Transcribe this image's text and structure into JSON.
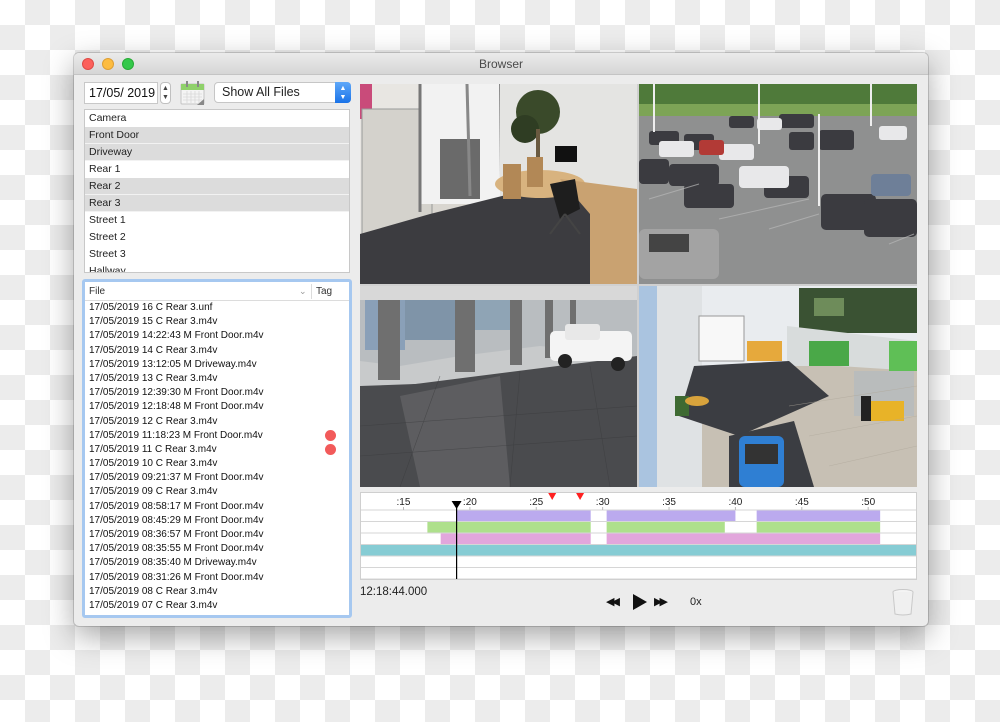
{
  "window": {
    "title": "Browser",
    "controls": [
      "close",
      "minimize",
      "maximize"
    ]
  },
  "toolbar": {
    "date_value": "17/05/ 2019",
    "calendar_icon": "calendar-icon",
    "filter_select_value": "Show All Files"
  },
  "camera_list": {
    "header": "Camera",
    "items": [
      {
        "label": "Front Door",
        "selected": true
      },
      {
        "label": "Driveway",
        "selected": true
      },
      {
        "label": "Rear 1",
        "selected": false
      },
      {
        "label": "Rear 2",
        "selected": true
      },
      {
        "label": "Rear 3",
        "selected": true
      },
      {
        "label": "Street 1",
        "selected": false
      },
      {
        "label": "Street 2",
        "selected": false
      },
      {
        "label": "Street 3",
        "selected": false
      },
      {
        "label": "Hallway",
        "selected": false
      }
    ]
  },
  "file_list": {
    "columns": {
      "file": "File",
      "tag": "Tag"
    },
    "rows": [
      {
        "name": "17/05/2019 16 C Rear 3.unf",
        "tagged": false
      },
      {
        "name": "17/05/2019 15 C Rear 3.m4v",
        "tagged": false
      },
      {
        "name": "17/05/2019 14:22:43 M Front Door.m4v",
        "tagged": false
      },
      {
        "name": "17/05/2019 14 C Rear 3.m4v",
        "tagged": false
      },
      {
        "name": "17/05/2019 13:12:05 M Driveway.m4v",
        "tagged": false
      },
      {
        "name": "17/05/2019 13 C Rear 3.m4v",
        "tagged": false
      },
      {
        "name": "17/05/2019 12:39:30 M Front Door.m4v",
        "tagged": false
      },
      {
        "name": "17/05/2019 12:18:48 M Front Door.m4v",
        "tagged": false
      },
      {
        "name": "17/05/2019 12 C Rear 3.m4v",
        "tagged": false
      },
      {
        "name": "17/05/2019 11:18:23 M Front Door.m4v",
        "tagged": true
      },
      {
        "name": "17/05/2019 11 C Rear 3.m4v",
        "tagged": true
      },
      {
        "name": "17/05/2019 10 C Rear 3.m4v",
        "tagged": false
      },
      {
        "name": "17/05/2019 09:21:37 M Front Door.m4v",
        "tagged": false
      },
      {
        "name": "17/05/2019 09 C Rear 3.m4v",
        "tagged": false
      },
      {
        "name": "17/05/2019 08:58:17 M Front Door.m4v",
        "tagged": false
      },
      {
        "name": "17/05/2019 08:45:29 M Front Door.m4v",
        "tagged": false
      },
      {
        "name": "17/05/2019 08:36:57 M Front Door.m4v",
        "tagged": false
      },
      {
        "name": "17/05/2019 08:35:55 M Front Door.m4v",
        "tagged": false
      },
      {
        "name": "17/05/2019 08:35:40 M Driveway.m4v",
        "tagged": false
      },
      {
        "name": "17/05/2019 08:31:26 M Front Door.m4v",
        "tagged": false
      },
      {
        "name": "17/05/2019 08 C Rear 3.m4v",
        "tagged": false
      },
      {
        "name": "17/05/2019 07 C Rear 3.m4v",
        "tagged": false
      }
    ],
    "tag_color": "#f25a5a"
  },
  "video_tiles": [
    {
      "scene": "office"
    },
    {
      "scene": "parking-lot"
    },
    {
      "scene": "garage-showroom"
    },
    {
      "scene": "lobby"
    }
  ],
  "timeline": {
    "range_seconds": [
      11.8,
      53.6
    ],
    "ticks": [
      {
        "label": ":15",
        "t": 15
      },
      {
        "label": ":20",
        "t": 20
      },
      {
        "label": ":25",
        "t": 25
      },
      {
        "label": ":30",
        "t": 30
      },
      {
        "label": ":35",
        "t": 35
      },
      {
        "label": ":40",
        "t": 40
      },
      {
        "label": ":45",
        "t": 45
      },
      {
        "label": ":50",
        "t": 50
      }
    ],
    "playhead_t": 19.0,
    "markers_t": [
      26.2,
      28.3
    ],
    "marker_color": "#ff2020",
    "tracks": [
      {
        "color": "#bbaaee",
        "segments": [
          [
            19.0,
            29.1
          ],
          [
            30.3,
            40.0
          ],
          [
            41.6,
            50.9
          ]
        ]
      },
      {
        "color": "#aee08c",
        "segments": [
          [
            16.8,
            29.1
          ],
          [
            30.3,
            39.2
          ],
          [
            41.6,
            50.9
          ]
        ]
      },
      {
        "color": "#e2a6dc",
        "segments": [
          [
            17.8,
            29.1
          ],
          [
            30.3,
            50.9
          ]
        ]
      },
      {
        "color": "#86ccd4",
        "segments": [
          [
            11.8,
            53.6
          ]
        ]
      },
      {
        "color": "#ffffff",
        "segments": []
      },
      {
        "color": "#ffffff",
        "segments": []
      }
    ]
  },
  "playback": {
    "current_time": "12:18:44.000",
    "speed": "0x",
    "rewind_glyph": "◀◀",
    "ff_glyph": "▶▶"
  }
}
